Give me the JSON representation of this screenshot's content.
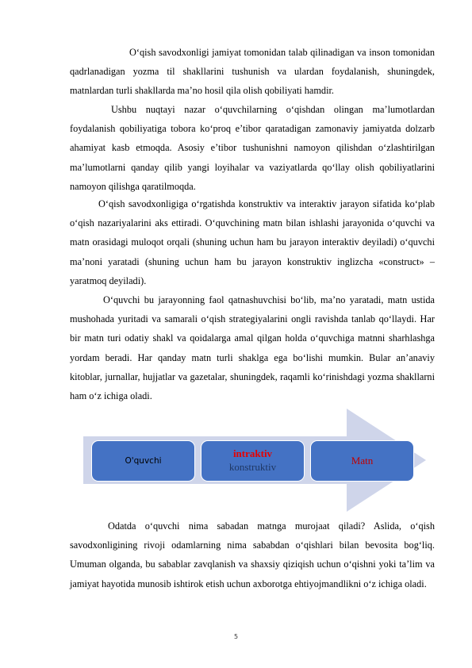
{
  "paragraphs": [
    "O‘qish savodxonligi jamiyat tomonidan talab qilinadigan va inson tomonidan qadrlanadigan yozma til shakllarini tushunish va ulardan foydalanish, shuningdek, matnlardan turli shakllarda ma’no hosil qila olish qobiliyati hamdir.",
    "Ushbu nuqtayi nazar o‘quvchilarning o‘qishdan olingan ma’lumotlardan foydalanish qobiliyatiga tobora ko‘proq e’tibor qaratadigan zamonaviy jamiyatda dolzarb ahamiyat kasb etmoqda. Asosiy e’tibor tushunishni namoyon qilishdan o‘zlashtirilgan ma’lumotlarni qanday qilib yangi loyihalar va vaziyatlarda qo‘llay olish qobiliyatlarini namoyon qilishga qaratilmoqda.",
    "O‘qish savodxonligiga o‘rgatishda konstruktiv va interaktiv jarayon sifatida ko‘plab o‘qish nazariyalarini aks ettiradi. O‘quvchining matn bilan ishlashi jarayonida o‘quvchi va matn orasidagi muloqot orqali (shuning uchun ham bu jarayon interaktiv deyiladi) o‘quvchi ma’noni yaratadi (shuning uchun ham bu jarayon konstruktiv inglizcha «construct» – yaratmoq deyiladi).",
    "O‘quvchi bu jarayonning faol qatnashuvchisi bo‘lib, ma’no yaratadi, matn ustida mushohada yuritadi va samarali o‘qish strategiyalarini ongli ravishda tanlab qo‘llaydi. Har bir matn turi odatiy shakl va qoidalarga amal qilgan holda o‘quvchiga matnni sharhlashga yordam beradi. Har qanday matn turli shaklga ega bo‘lishi mumkin. Bular an’anaviy kitoblar, jurnallar, hujjatlar va gazetalar, shuningdek, raqamli ko‘rinishdagi yozma shakllarni ham o‘z ichiga oladi.",
    "Odatda o‘quvchi nima sabadan matnga murojaat qiladi? Aslida, o‘qish savodxonligining rivoji odamlarning nima sababdan o‘qishlari bilan bevosita bog‘liq. Umuman olganda, bu sabablar zavqlanish va shaxsiy qiziqish uchun o‘qishni yoki ta’lim va jamiyat hayotida munosib ishtirok etish uchun axborotga ehtiyojmandlikni o‘z ichiga oladi."
  ],
  "diagram": {
    "arrow_icon": "process-arrow",
    "boxes": [
      {
        "label": "O'quvchi"
      },
      {
        "label_top": "intraktiv",
        "label_bottom": "konstruktiv"
      },
      {
        "label": "Matn"
      }
    ],
    "colors": {
      "box_fill": "#4472c4",
      "arrow_fill": "#cfd5ea",
      "highlight_red": "#e60000",
      "matn_red": "#c00000",
      "konstruktiv_navy": "#1f3864"
    }
  },
  "page_number": "5"
}
